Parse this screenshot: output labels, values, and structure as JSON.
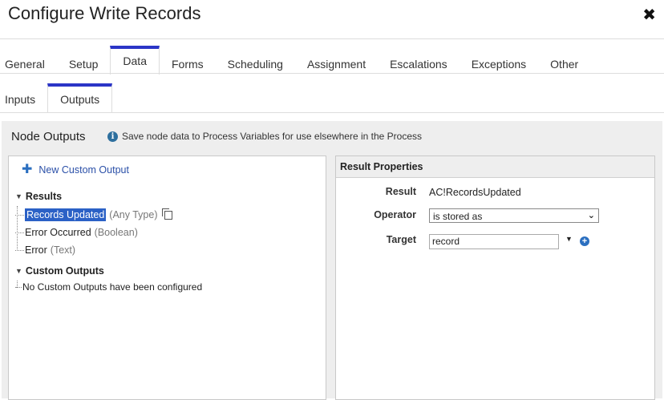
{
  "dialog": {
    "title": "Configure Write Records",
    "close_symbol": "✖"
  },
  "tabs": [
    "General",
    "Setup",
    "Data",
    "Forms",
    "Scheduling",
    "Assignment",
    "Escalations",
    "Exceptions",
    "Other"
  ],
  "active_tab": "Data",
  "subtabs": [
    "Inputs",
    "Outputs"
  ],
  "active_subtab": "Outputs",
  "section": {
    "title": "Node Outputs",
    "info_text": "Save node data to Process Variables for use elsewhere in the Process"
  },
  "left_panel": {
    "new_output_label": "New Custom Output",
    "results_group": "Results",
    "results": [
      {
        "name": "Records Updated",
        "type": "(Any Type)",
        "selected": true
      },
      {
        "name": "Error Occurred",
        "type": "(Boolean)",
        "selected": false
      },
      {
        "name": "Error",
        "type": "(Text)",
        "selected": false
      }
    ],
    "custom_group": "Custom Outputs",
    "custom_empty": "No Custom Outputs have been configured"
  },
  "result_properties": {
    "header": "Result Properties",
    "result_label": "Result",
    "result_value": "AC!RecordsUpdated",
    "operator_label": "Operator",
    "operator_value": "is stored as",
    "target_label": "Target",
    "target_value": "record"
  },
  "colors": {
    "accent": "#2b35c7",
    "selection": "#2b61c6",
    "link": "#2b50a8",
    "panel_bg": "#eeeeee"
  }
}
